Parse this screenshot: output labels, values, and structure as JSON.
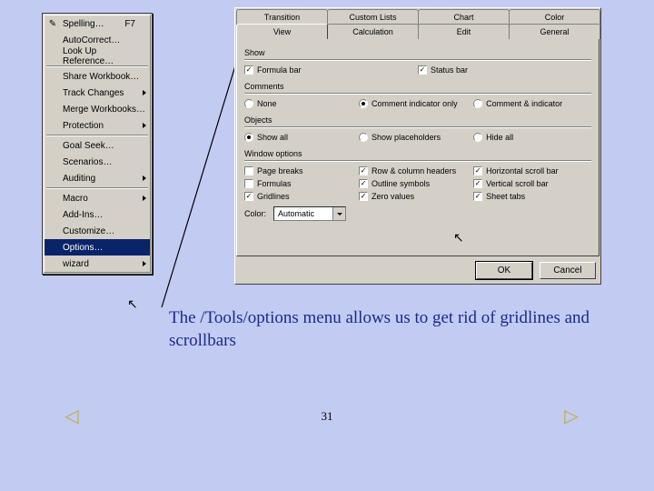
{
  "menu": {
    "items": [
      {
        "label": "Spelling…",
        "shortcut": "F7",
        "icon": "✓",
        "arrow": false
      },
      {
        "label": "AutoCorrect…",
        "arrow": false
      },
      {
        "label": "Look Up Reference…",
        "arrow": false
      }
    ],
    "group2": [
      {
        "label": "Share Workbook…",
        "arrow": false
      },
      {
        "label": "Track Changes",
        "arrow": true
      },
      {
        "label": "Merge Workbooks…",
        "arrow": false
      },
      {
        "label": "Protection",
        "arrow": true
      }
    ],
    "group3": [
      {
        "label": "Goal Seek…",
        "arrow": false
      },
      {
        "label": "Scenarios…",
        "arrow": false
      },
      {
        "label": "Auditing",
        "arrow": true
      }
    ],
    "group4": [
      {
        "label": "Macro",
        "arrow": true
      },
      {
        "label": "Add-Ins…",
        "arrow": false
      },
      {
        "label": "Customize…",
        "arrow": false
      },
      {
        "label": "Options…",
        "arrow": false,
        "selected": true
      },
      {
        "label": "wizard",
        "arrow": true
      }
    ]
  },
  "dialog": {
    "tabs_row1": [
      "Transition",
      "Custom Lists",
      "Chart",
      "Color"
    ],
    "tabs_row2": [
      "View",
      "Calculation",
      "Edit",
      "General"
    ],
    "active_tab": "View",
    "show": {
      "title": "Show",
      "formula_bar": {
        "label": "Formula bar",
        "checked": true
      },
      "status_bar": {
        "label": "Status bar",
        "checked": true
      }
    },
    "comments": {
      "title": "Comments",
      "none": {
        "label": "None"
      },
      "indic": {
        "label": "Comment indicator only",
        "checked": true
      },
      "both": {
        "label": "Comment & indicator"
      }
    },
    "objects": {
      "title": "Objects",
      "show_all": {
        "label": "Show all",
        "checked": true
      },
      "placeholders": {
        "label": "Show placeholders"
      },
      "hide_all": {
        "label": "Hide all"
      }
    },
    "window": {
      "title": "Window options",
      "page_breaks": {
        "label": "Page breaks",
        "checked": false
      },
      "formulas": {
        "label": "Formulas",
        "checked": false
      },
      "gridlines": {
        "label": "Gridlines",
        "checked": true
      },
      "headers": {
        "label": "Row & column headers",
        "checked": true
      },
      "outline": {
        "label": "Outline symbols",
        "checked": true
      },
      "zero": {
        "label": "Zero values",
        "checked": true
      },
      "hscroll": {
        "label": "Horizontal scroll bar",
        "checked": true
      },
      "vscroll": {
        "label": "Vertical scroll bar",
        "checked": true
      },
      "tabs": {
        "label": "Sheet tabs",
        "checked": true
      },
      "color_label": "Color:",
      "color_value": "Automatic"
    },
    "buttons": {
      "ok": "OK",
      "cancel": "Cancel"
    }
  },
  "caption": "The /Tools/options menu allows us to get rid of gridlines and scrollbars",
  "page_number": "31"
}
